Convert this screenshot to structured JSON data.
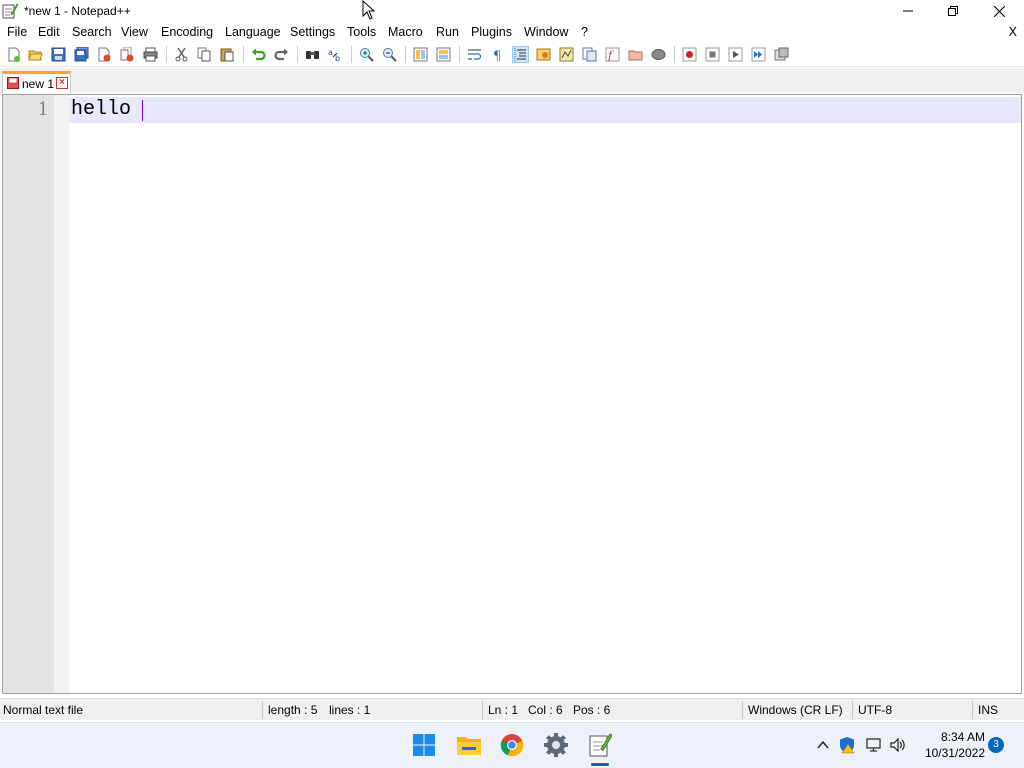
{
  "window": {
    "title": "*new 1 - Notepad++"
  },
  "menu": {
    "items": [
      "File",
      "Edit",
      "Search",
      "View",
      "Encoding",
      "Language",
      "Settings",
      "Tools",
      "Macro",
      "Run",
      "Plugins",
      "Window",
      "?"
    ],
    "close_label": "X"
  },
  "toolbar": {
    "icons": [
      "new-file-icon",
      "open-file-icon",
      "save-icon",
      "save-all-icon",
      "close-icon",
      "close-all-icon",
      "print-icon",
      "cut-icon",
      "copy-icon",
      "paste-icon",
      "undo-icon",
      "redo-icon",
      "find-icon",
      "replace-icon",
      "zoom-in-icon",
      "zoom-out-icon",
      "sync-vertical-icon",
      "sync-horizontal-icon",
      "word-wrap-icon",
      "show-all-chars-icon",
      "indent-guide-icon",
      "user-language-icon",
      "doc-map-icon",
      "function-list-icon",
      "folder-workspace-icon",
      "monitoring-icon",
      "record-macro-icon",
      "stop-macro-icon",
      "play-macro-icon",
      "run-macro-multiple-icon",
      "save-macro-icon"
    ]
  },
  "tabs": [
    {
      "label": "new 1",
      "modified": true
    }
  ],
  "editor": {
    "line_numbers": [
      "1"
    ],
    "lines": [
      "hello"
    ]
  },
  "status": {
    "file_type": "Normal text file",
    "length": "length : 5",
    "lines": "lines : 1",
    "ln": "Ln : 1",
    "col": "Col : 6",
    "pos": "Pos : 6",
    "eol": "Windows (CR LF)",
    "encoding": "UTF-8",
    "mode": "INS"
  },
  "taskbar": {
    "apps": [
      "windows-start-icon",
      "file-explorer-icon",
      "chrome-icon",
      "settings-icon",
      "notepadpp-icon"
    ],
    "time": "8:34 AM",
    "date": "10/31/2022",
    "notification_count": "3"
  },
  "colors": {
    "current_line": "#e8e8ff",
    "caret": "#8000ff",
    "tab_accent": "#f7a23a",
    "taskbar_accent": "#0067c0"
  }
}
